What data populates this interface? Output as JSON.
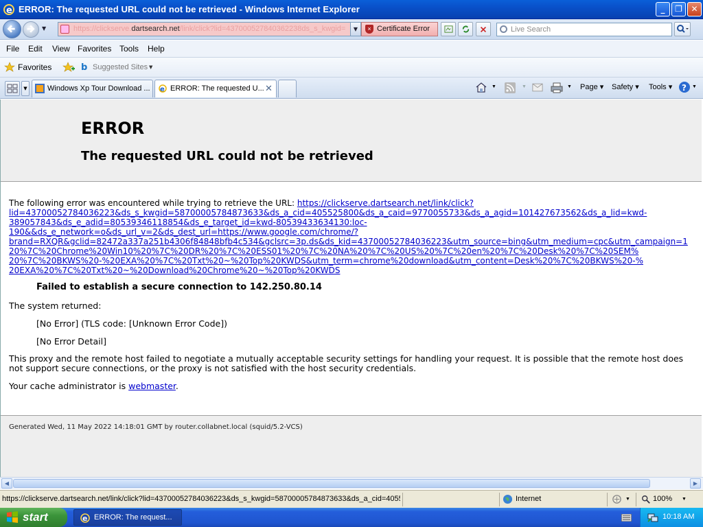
{
  "window": {
    "title": "ERROR: The requested URL could not be retrieved - Windows Internet Explorer"
  },
  "nav": {
    "address_prefix": "https://clickserve.",
    "address_domain": "dartsearch.net",
    "address_rest": "/link/click?lid=437000527840362238ds_s_kwgid=",
    "cert_error": "Certificate Error",
    "search_placeholder": "Live Search"
  },
  "menu": [
    "File",
    "Edit",
    "View",
    "Favorites",
    "Tools",
    "Help"
  ],
  "favorites": {
    "label": "Favorites",
    "suggested": "Suggested Sites"
  },
  "tabs": [
    {
      "label": "Windows Xp Tour Download ...",
      "active": false
    },
    {
      "label": "ERROR: The requested U...",
      "active": true
    }
  ],
  "toolbar": {
    "page": "Page",
    "safety": "Safety",
    "tools": "Tools"
  },
  "page": {
    "heading": "ERROR",
    "subheading": "The requested URL could not be retrieved",
    "intro": "The following error was encountered while trying to retrieve the URL: ",
    "url_lines": [
      "https://clickserve.dartsearch.net/link/click?",
      "lid=43700052784036223&ds_s_kwgid=58700005784873633&ds_a_cid=405525800&ds_a_caid=9770055733&ds_a_agid=101427673562&ds_a_lid=kwd-",
      "389057843&ds_e_adid=80539346118854&ds_e_target_id=kwd-80539433634130:loc-",
      "190&&ds_e_network=o&ds_url_v=2&ds_dest_url=https://www.google.com/chrome/?",
      "brand=RXQR&gclid=82472a337a251b4306f84848bfb4c534&gclsrc=3p.ds&ds_kid=43700052784036223&utm_source=bing&utm_medium=cpc&utm_campaign=1",
      "20%7C%20Chrome%20Win10%20%7C%20DR%20%7C%20ESS01%20%7C%20NA%20%7C%20US%20%7C%20en%20%7C%20Desk%20%7C%20SEM%",
      "20%7C%20BKWS%20-%20EXA%20%7C%20Txt%20~%20Top%20KWDS&utm_term=chrome%20download&utm_content=Desk%20%7C%20BKWS%20-%",
      "20EXA%20%7C%20Txt%20~%20Download%20Chrome%20~%20Top%20KWDS"
    ],
    "failed": "Failed to establish a secure connection to 142.250.80.14",
    "system_returned": "The system returned:",
    "no_error": "[No Error] (TLS code: [Unknown Error Code])",
    "no_error_detail": "[No Error Detail]",
    "explain_1": "This proxy and the remote host failed to negotiate a mutually acceptable security settings for handling your request. It is possible that the remote host does",
    "explain_2": "not support secure connections, or the proxy is not satisfied with the host security credentials.",
    "cache_admin": "Your cache administrator is ",
    "webmaster": "webmaster",
    "period": ".",
    "generated": "Generated Wed, 11 May 2022 14:18:01 GMT by router.collabnet.local (squid/5.2-VCS)"
  },
  "status": {
    "url": "https://clickserve.dartsearch.net/link/click?lid=43700052784036223&ds_s_kwgid=58700005784873633&ds_a_cid=40552",
    "zone": "Internet",
    "zoom": "100%"
  },
  "taskbar": {
    "start": "start",
    "item": "ERROR: The request...",
    "clock": "10:18 AM"
  },
  "colors": {
    "title_blue": "#0950c9",
    "link": "#0000cc",
    "cert_error_bg": "#f6c9c9",
    "start_green": "#3b943a"
  }
}
